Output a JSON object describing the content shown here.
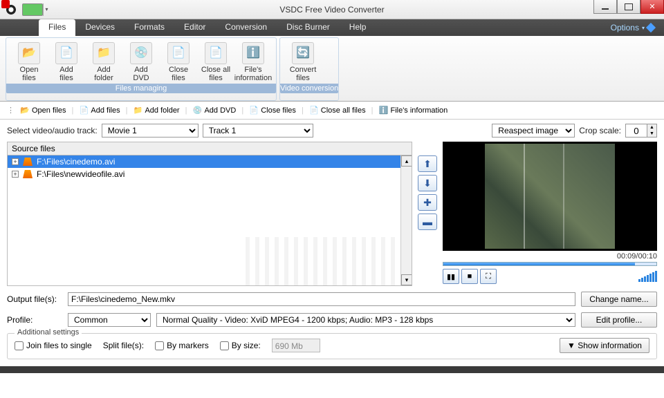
{
  "window": {
    "title": "VSDC Free Video Converter"
  },
  "menubar": {
    "tabs": [
      "Files",
      "Devices",
      "Formats",
      "Editor",
      "Conversion",
      "Disc Burner",
      "Help"
    ],
    "active": 0,
    "options_label": "Options"
  },
  "ribbon": {
    "groups": [
      {
        "label": "Files managing",
        "buttons": [
          {
            "label": "Open\nfiles",
            "icon": "📂"
          },
          {
            "label": "Add\nfiles",
            "icon": "📄"
          },
          {
            "label": "Add\nfolder",
            "icon": "📁"
          },
          {
            "label": "Add\nDVD",
            "icon": "💿"
          },
          {
            "label": "Close\nfiles",
            "icon": "📄"
          },
          {
            "label": "Close all\nfiles",
            "icon": "📄"
          },
          {
            "label": "File's\ninformation",
            "icon": "ℹ️"
          }
        ]
      },
      {
        "label": "Video conversion",
        "buttons": [
          {
            "label": "Convert\nfiles",
            "icon": "🔄"
          }
        ]
      }
    ]
  },
  "quickbar": [
    {
      "label": "Open files",
      "icon": "📂"
    },
    {
      "label": "Add files",
      "icon": "📄"
    },
    {
      "label": "Add folder",
      "icon": "📁"
    },
    {
      "label": "Add DVD",
      "icon": "💿"
    },
    {
      "label": "Close files",
      "icon": "📄"
    },
    {
      "label": "Close all files",
      "icon": "📄"
    },
    {
      "label": "File's information",
      "icon": "ℹ️"
    }
  ],
  "track_selector": {
    "label": "Select video/audio track:",
    "movie": "Movie 1",
    "track": "Track 1"
  },
  "preview": {
    "mode_label": "Reaspect image",
    "crop_label": "Crop scale:",
    "crop_value": "0",
    "time": "00:09/00:10"
  },
  "source": {
    "header": "Source files",
    "files": [
      {
        "path": "F:\\Files\\cinedemo.avi",
        "selected": true
      },
      {
        "path": "F:\\Files\\newvideofile.avi",
        "selected": false
      }
    ]
  },
  "output": {
    "label": "Output file(s):",
    "value": "F:\\Files\\cinedemo_New.mkv",
    "change_btn": "Change name...",
    "profile_label": "Profile:",
    "profile_group": "Common",
    "profile_detail": "Normal Quality - Video: XviD MPEG4 - 1200 kbps; Audio: MP3 - 128 kbps",
    "edit_btn": "Edit profile..."
  },
  "additional": {
    "legend": "Additional settings",
    "join_label": "Join files to single",
    "split_label": "Split file(s):",
    "by_markers": "By markers",
    "by_size": "By size:",
    "size_value": "690 Mb",
    "show_info": "▼ Show information"
  }
}
